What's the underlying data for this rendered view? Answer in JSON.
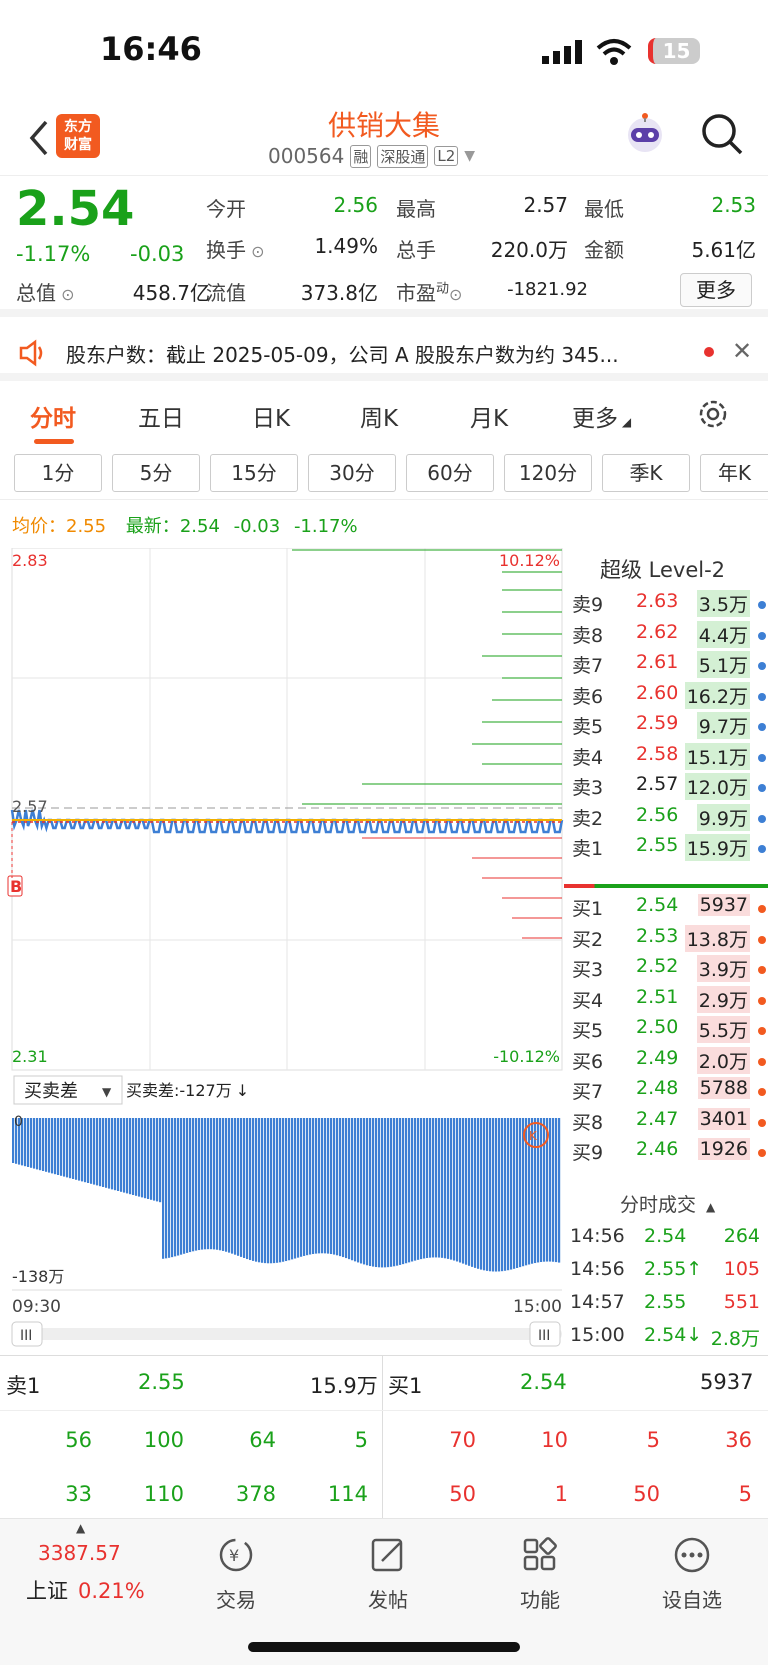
{
  "status": {
    "time": "16:46",
    "battery": "15"
  },
  "header": {
    "logo_line1": "东方",
    "logo_line2": "财富",
    "name": "供销大集",
    "code": "000564",
    "tags": [
      "融",
      "深股通",
      "L2"
    ]
  },
  "quote": {
    "price": "2.54",
    "pct": "-1.17%",
    "chg": "-0.03",
    "open_lbl": "今开",
    "open": "2.56",
    "high_lbl": "最高",
    "high": "2.57",
    "low_lbl": "最低",
    "low": "2.53",
    "turnover_lbl": "换手",
    "turnover": "1.49%",
    "volume_lbl": "总手",
    "volume": "220.0万",
    "amount_lbl": "金额",
    "amount": "5.61亿",
    "mktcap_lbl": "总值",
    "mktcap": "458.7亿",
    "float_lbl": "流值",
    "float": "373.8亿",
    "pe_lbl": "市盈",
    "pe_sup": "动",
    "pe": "-1821.92",
    "more": "更多"
  },
  "notice": {
    "text": "股东户数：截止 2025-05-09，公司 A 股股东户数为约 345..."
  },
  "tabs": [
    "分时",
    "五日",
    "日K",
    "周K",
    "月K",
    "更多"
  ],
  "periods": [
    "1分",
    "5分",
    "15分",
    "30分",
    "60分",
    "120分",
    "季K",
    "年K"
  ],
  "avg": {
    "avg_lbl": "均价：",
    "avg": "2.55",
    "last_lbl": "最新：",
    "last": "2.54",
    "chg": "-0.03",
    "pct": "-1.17%"
  },
  "chart": {
    "y_top": "2.83",
    "y_bottom": "2.31",
    "y_ref": "2.57",
    "pct_top": "10.12%",
    "pct_bottom": "-10.12%",
    "marker": "B",
    "ind_name": "买卖差",
    "ind_value": "买卖差:-127万",
    "ind_zero": "0",
    "ind_min": "-138万",
    "t_start": "09:30",
    "t_end": "15:00",
    "level2": "超级 Level-2"
  },
  "book": {
    "asks": [
      [
        "卖9",
        "2.63",
        "3.5万"
      ],
      [
        "卖8",
        "2.62",
        "4.4万"
      ],
      [
        "卖7",
        "2.61",
        "5.1万"
      ],
      [
        "卖6",
        "2.60",
        "16.2万"
      ],
      [
        "卖5",
        "2.59",
        "9.7万"
      ],
      [
        "卖4",
        "2.58",
        "15.1万"
      ],
      [
        "卖3",
        "2.57",
        "12.0万"
      ],
      [
        "卖2",
        "2.56",
        "9.9万"
      ],
      [
        "卖1",
        "2.55",
        "15.9万"
      ]
    ],
    "bids": [
      [
        "买1",
        "2.54",
        "5937"
      ],
      [
        "买2",
        "2.53",
        "13.8万"
      ],
      [
        "买3",
        "2.52",
        "3.9万"
      ],
      [
        "买4",
        "2.51",
        "2.9万"
      ],
      [
        "买5",
        "2.50",
        "5.5万"
      ],
      [
        "买6",
        "2.49",
        "2.0万"
      ],
      [
        "买7",
        "2.48",
        "5788"
      ],
      [
        "买8",
        "2.47",
        "3401"
      ],
      [
        "买9",
        "2.46",
        "1926"
      ]
    ]
  },
  "trades": {
    "header": "分时成交",
    "rows": [
      [
        "14:56",
        "2.54",
        "264"
      ],
      [
        "14:56",
        "2.55↑",
        "105"
      ],
      [
        "14:57",
        "2.55",
        "551"
      ],
      [
        "15:00",
        "2.54↓",
        "2.8万"
      ]
    ]
  },
  "bottom": {
    "ask_lbl": "卖1",
    "ask_price": "2.55",
    "ask_vol": "15.9万",
    "bid_lbl": "买1",
    "bid_price": "2.54",
    "bid_vol": "5937",
    "ask_q1": [
      "56",
      "100",
      "64",
      "5"
    ],
    "ask_q2": [
      "33",
      "110",
      "378",
      "114"
    ],
    "bid_q1": [
      "70",
      "10",
      "5",
      "36"
    ],
    "bid_q2": [
      "50",
      "1",
      "50",
      "5"
    ]
  },
  "tabbar": {
    "index_val": "3387.57",
    "index_name": "上证",
    "index_pct": "0.21%",
    "items": [
      "交易",
      "发帖",
      "功能",
      "设自选"
    ]
  },
  "colors": {
    "up": "#e8322f",
    "down": "#1aa11a",
    "accent": "#f25a20",
    "line": "#3d7fd4"
  }
}
